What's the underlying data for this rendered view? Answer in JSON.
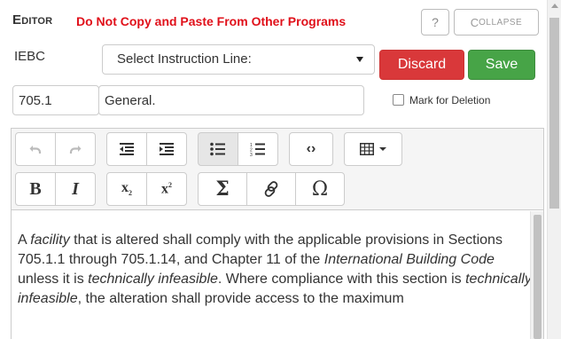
{
  "header": {
    "title_first": "E",
    "title_rest": "DITOR",
    "warning": "Do Not Copy and Paste From Other Programs",
    "help_label": "?",
    "collapse_first": "C",
    "collapse_rest": "OLLAPSE"
  },
  "row1": {
    "code_label": "IEBC",
    "select_value": "Select Instruction Line:",
    "discard_label": "Discard",
    "save_label": "Save"
  },
  "row2": {
    "section_number": "705.1",
    "section_title": "General.",
    "mark_for_deletion_label": "Mark for Deletion",
    "mark_for_deletion_checked": false
  },
  "toolbar": {
    "row1": [
      "undo-icon",
      "redo-icon",
      "outdent-icon",
      "indent-icon",
      "bulleted-list-icon",
      "numbered-list-icon",
      "code-view-icon",
      "table-icon"
    ],
    "row2": [
      "bold-icon",
      "italic-icon",
      "subscript-icon",
      "superscript-icon",
      "sigma-icon",
      "link-icon",
      "omega-icon"
    ],
    "bold_glyph": "B",
    "italic_glyph": "I",
    "subscript_base": "x",
    "subscript_mark": "2",
    "superscript_base": "x",
    "superscript_mark": "2",
    "sigma_glyph": "Σ",
    "omega_glyph": "Ω",
    "code_glyph": "‹›"
  },
  "content": {
    "seg1": "A ",
    "seg2": "facility",
    "seg3": " that is altered shall comply with the applicable provisions in Sections 705.1.1 through 705.1.14, and Chapter 11 of the ",
    "seg4": "International Building Code",
    "seg5": " unless it is ",
    "seg6": "technically infeasible",
    "seg7": ". Where compliance with this section is ",
    "seg8": "technically infeasible",
    "seg9": ", the alteration shall provide access to the maximum"
  },
  "colors": {
    "warning": "#e0101a",
    "discard": "#d9383a",
    "save": "#47a447"
  }
}
